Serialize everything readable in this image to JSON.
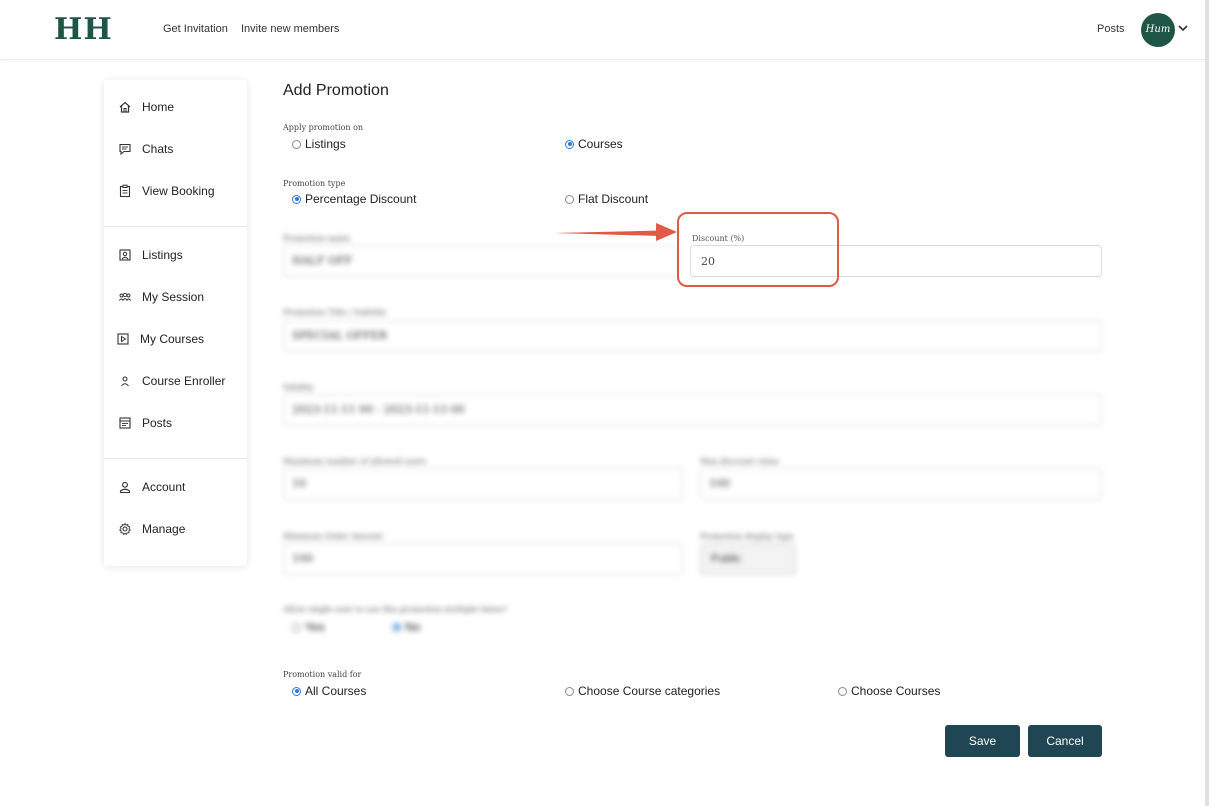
{
  "header": {
    "logo": "HH",
    "nav": [
      "Get Invitation",
      "Invite new members"
    ],
    "posts": "Posts",
    "avatar_text": "Hum"
  },
  "sidebar": {
    "group1": [
      {
        "label": "Home",
        "icon": "home-icon"
      },
      {
        "label": "Chats",
        "icon": "chat-icon"
      },
      {
        "label": "View Booking",
        "icon": "clipboard-icon"
      }
    ],
    "group2": [
      {
        "label": "Listings",
        "icon": "listing-icon"
      },
      {
        "label": "My Session",
        "icon": "group-icon"
      },
      {
        "label": "My Courses",
        "icon": "play-icon"
      },
      {
        "label": "Course Enroller",
        "icon": "user-icon"
      },
      {
        "label": "Posts",
        "icon": "posts-icon"
      }
    ],
    "group3": [
      {
        "label": "Account",
        "icon": "account-icon"
      },
      {
        "label": "Manage",
        "icon": "gear-icon"
      }
    ]
  },
  "main": {
    "title": "Add Promotion",
    "apply_on": {
      "label": "Apply promotion on",
      "options": [
        {
          "label": "Listings",
          "selected": false
        },
        {
          "label": "Courses",
          "selected": true
        }
      ]
    },
    "promotion_type": {
      "label": "Promotion type",
      "options": [
        {
          "label": "Percentage Discount",
          "selected": true
        },
        {
          "label": "Flat Discount",
          "selected": false
        }
      ]
    },
    "discount": {
      "label": "Discount (%)",
      "value": "20"
    },
    "blurred": {
      "name_label": "Promotion name",
      "name_value": "HALF OFF",
      "title_label": "Promotion Title / Subtitle",
      "title_value": "SPECIAL OFFER",
      "validity_label": "Validity",
      "validity_value": "2023-11-11 00 - 2023-11-13 00",
      "max_label": "Maximum number of allowed users",
      "max_value": "10",
      "max_disc_label": "Max discount value",
      "max_disc_value": "100",
      "min_label": "Minimum Order Amount",
      "min_value": "100",
      "visibility_label": "Promotion display type",
      "visibility_value": "Public",
      "single_label": "Allow single user to use this promotion multiple times?",
      "yes": "Yes",
      "no": "No"
    },
    "valid_for": {
      "label": "Promotion valid for",
      "options": [
        {
          "label": "All Courses",
          "selected": true
        },
        {
          "label": "Choose Course categories",
          "selected": false
        },
        {
          "label": "Choose Courses",
          "selected": false
        }
      ]
    },
    "save": "Save",
    "cancel": "Cancel"
  },
  "colors": {
    "brand": "#1f5544",
    "button": "#1f4652",
    "radio_on": "#2b7bd0",
    "highlight": "#e05a45"
  }
}
